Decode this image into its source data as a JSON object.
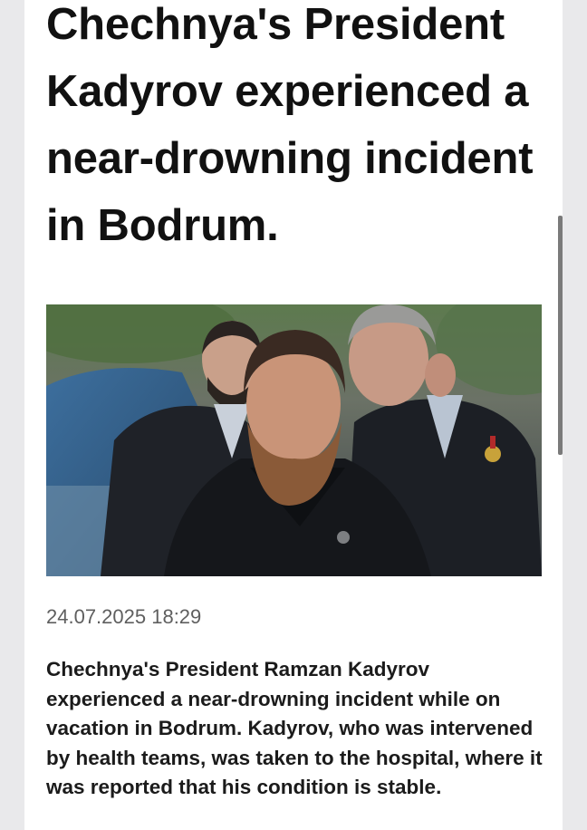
{
  "article": {
    "headline": "Chechnya's President Kadyrov experienced a near-drowning incident in Bodrum.",
    "photo_icon": "news-photo",
    "timestamp": "24.07.2025 18:29",
    "body": "Chechnya's President Ramzan Kadyrov experienced a near-drowning incident while on vacation in Bodrum. Kadyrov, who was intervened by health teams, was taken to the hospital, where it was reported that his condition is stable."
  },
  "colors": {
    "page_background": "#e9e9eb",
    "card_background": "#ffffff",
    "headline_text": "#111111",
    "timestamp_text": "#5f5f5f"
  }
}
